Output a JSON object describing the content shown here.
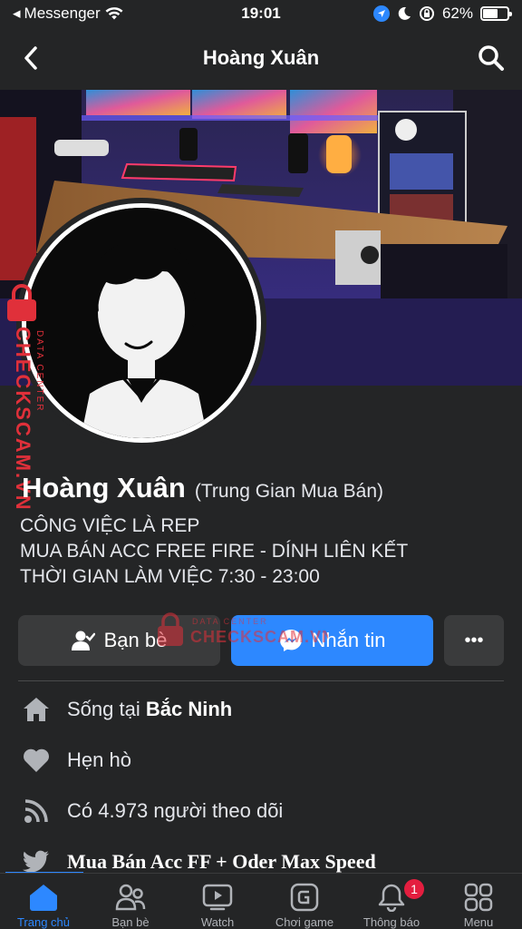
{
  "status_bar": {
    "back_app": "Messenger",
    "time": "19:01",
    "battery": "62%",
    "battery_level": 0.62
  },
  "header": {
    "title": "Hoàng Xuân"
  },
  "watermark": {
    "brand": "CHECKSCAM.VN",
    "sub": "DATA CENTER"
  },
  "profile": {
    "name": "Hoàng Xuân",
    "alternate_name": "(Trung Gian Mua Bán)",
    "bio": [
      "CÔNG VIỆC LÀ REP",
      "MUA BÁN ACC FREE FIRE - DÍNH LIÊN KẾT",
      "THỜI GIAN LÀM VIỆC 7:30 - 23:00"
    ]
  },
  "actions": {
    "friends_label": "Bạn bè",
    "message_label": "Nhắn tin",
    "more_label": "•••"
  },
  "info": {
    "lives_prefix": "Sống tại ",
    "lives_place": "Bắc Ninh",
    "dating": "Hẹn hò",
    "followers": "Có 4.973 người theo dõi",
    "twitter": "Mua Bán Acc FF + Oder Max Speed"
  },
  "tabs": [
    {
      "label": "Trang chủ",
      "icon": "home-icon"
    },
    {
      "label": "Bạn bè",
      "icon": "friends-icon"
    },
    {
      "label": "Watch",
      "icon": "watch-icon"
    },
    {
      "label": "Chơi game",
      "icon": "gaming-icon"
    },
    {
      "label": "Thông báo",
      "icon": "bell-icon",
      "badge": "1"
    },
    {
      "label": "Menu",
      "icon": "menu-icon"
    }
  ],
  "colors": {
    "background": "#242526",
    "accent": "#2d88ff",
    "watermark": "#e0303a",
    "badge": "#e41e3f"
  }
}
